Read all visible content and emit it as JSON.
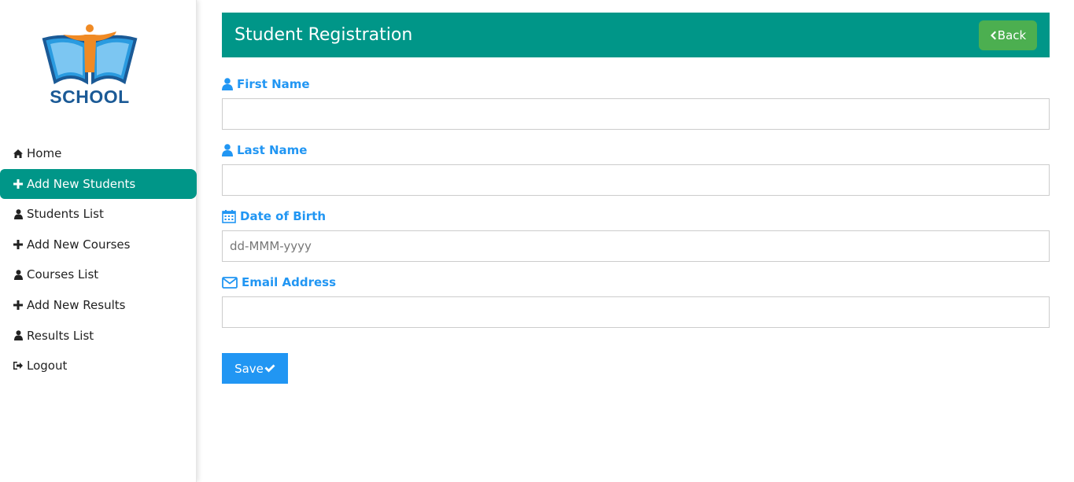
{
  "brand": {
    "logo_text": "SCHOOL"
  },
  "sidebar": {
    "items": [
      {
        "label": "Home",
        "icon": "home-icon"
      },
      {
        "label": "Add New Students",
        "icon": "plus-icon",
        "active": true
      },
      {
        "label": "Students List",
        "icon": "user-icon"
      },
      {
        "label": "Add New Courses",
        "icon": "plus-icon"
      },
      {
        "label": "Courses List",
        "icon": "user-icon"
      },
      {
        "label": "Add New Results",
        "icon": "plus-icon"
      },
      {
        "label": "Results List",
        "icon": "user-icon"
      },
      {
        "label": "Logout",
        "icon": "sign-out-icon"
      }
    ]
  },
  "header": {
    "title": "Student Registration",
    "back_label": "Back"
  },
  "form": {
    "first_name": {
      "label": "First Name",
      "value": "",
      "placeholder": ""
    },
    "last_name": {
      "label": "Last Name",
      "value": "",
      "placeholder": ""
    },
    "dob": {
      "label": "Date of Birth",
      "value": "",
      "placeholder": "dd-MMM-yyyy"
    },
    "email": {
      "label": "Email Address",
      "value": "",
      "placeholder": ""
    },
    "save_label": "Save"
  },
  "colors": {
    "accent": "#009688",
    "label_blue": "#2196f3",
    "back_green": "#4caf50",
    "logo_blue": "#1b5a96",
    "logo_orange": "#f08a24"
  }
}
